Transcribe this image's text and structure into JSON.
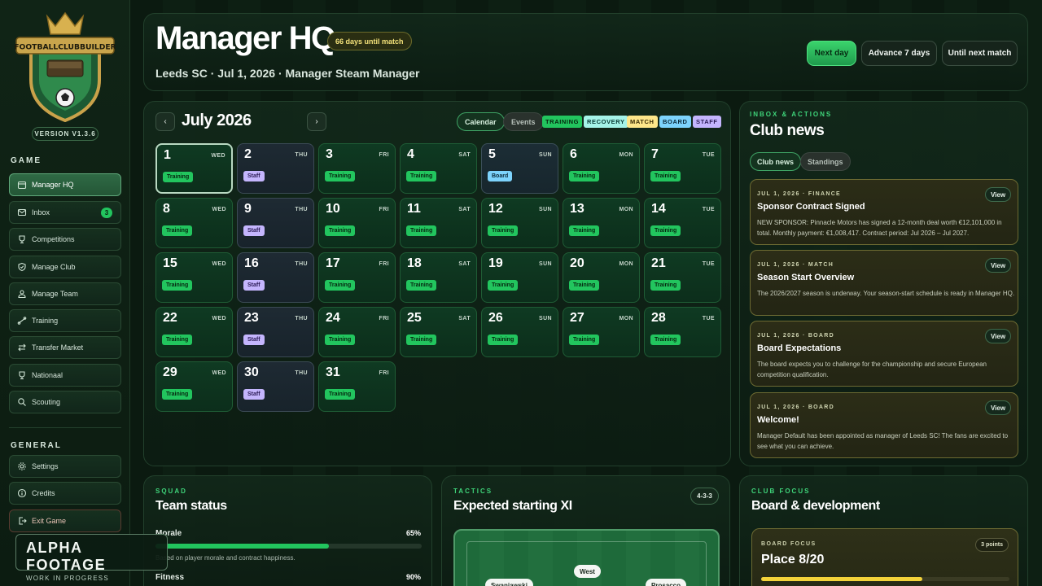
{
  "app": {
    "logo_text": "FOOTBALLCLUBBUILDER",
    "version": "VERSION V1.3.6"
  },
  "sidebar": {
    "game_label": "GAME",
    "general_label": "GENERAL",
    "items": [
      {
        "label": "Manager HQ",
        "icon": "calendar-icon",
        "active": true
      },
      {
        "label": "Inbox",
        "icon": "mail-icon",
        "badge": "3"
      },
      {
        "label": "Competitions",
        "icon": "trophy-icon"
      },
      {
        "label": "Manage Club",
        "icon": "shield-icon"
      },
      {
        "label": "Manage Team",
        "icon": "team-icon"
      },
      {
        "label": "Training",
        "icon": "training-icon"
      },
      {
        "label": "Transfer Market",
        "icon": "transfer-icon"
      },
      {
        "label": "Nationaal",
        "icon": "trophy-icon"
      },
      {
        "label": "Scouting",
        "icon": "search-icon"
      }
    ],
    "general_items": [
      {
        "label": "Settings",
        "icon": "gear-icon"
      },
      {
        "label": "Credits",
        "icon": "info-icon"
      },
      {
        "label": "Exit Game",
        "icon": "exit-icon"
      }
    ]
  },
  "watermark": {
    "title": "ALPHA FOOTAGE",
    "subtitle": "WORK IN PROGRESS"
  },
  "header": {
    "title": "Manager HQ",
    "countdown": "66 days until match",
    "subtitle": "Leeds SC · Jul 1, 2026 · Manager Steam Manager",
    "buttons": {
      "next_day": "Next day",
      "advance_7": "Advance 7 days",
      "until_match": "Until next match"
    }
  },
  "calendar": {
    "title": "July 2026",
    "prev": "‹",
    "next": "›",
    "view_calendar": "Calendar",
    "view_events": "Events",
    "legend": [
      {
        "label": "TRAINING",
        "color": "#22c55e"
      },
      {
        "label": "RECOVERY",
        "color": "#a5f3e8"
      },
      {
        "label": "MATCH",
        "color": "#fde68a"
      },
      {
        "label": "BOARD",
        "color": "#7dd3fc"
      },
      {
        "label": "STAFF",
        "color": "#c4b5fd"
      }
    ],
    "days": [
      {
        "num": "1",
        "dow": "WED",
        "event": "Training",
        "type": "training"
      },
      {
        "num": "2",
        "dow": "THU",
        "event": "Staff",
        "type": "staff"
      },
      {
        "num": "3",
        "dow": "FRI",
        "event": "Training",
        "type": "training"
      },
      {
        "num": "4",
        "dow": "SAT",
        "event": "Training",
        "type": "training"
      },
      {
        "num": "5",
        "dow": "SUN",
        "event": "Board",
        "type": "board"
      },
      {
        "num": "6",
        "dow": "MON",
        "event": "Training",
        "type": "training"
      },
      {
        "num": "7",
        "dow": "TUE",
        "event": "Training",
        "type": "training"
      },
      {
        "num": "8",
        "dow": "WED",
        "event": "Training",
        "type": "training"
      },
      {
        "num": "9",
        "dow": "THU",
        "event": "Staff",
        "type": "staff"
      },
      {
        "num": "10",
        "dow": "FRI",
        "event": "Training",
        "type": "training"
      },
      {
        "num": "11",
        "dow": "SAT",
        "event": "Training",
        "type": "training"
      },
      {
        "num": "12",
        "dow": "SUN",
        "event": "Training",
        "type": "training"
      },
      {
        "num": "13",
        "dow": "MON",
        "event": "Training",
        "type": "training"
      },
      {
        "num": "14",
        "dow": "TUE",
        "event": "Training",
        "type": "training"
      },
      {
        "num": "15",
        "dow": "WED",
        "event": "Training",
        "type": "training"
      },
      {
        "num": "16",
        "dow": "THU",
        "event": "Staff",
        "type": "staff"
      },
      {
        "num": "17",
        "dow": "FRI",
        "event": "Training",
        "type": "training"
      },
      {
        "num": "18",
        "dow": "SAT",
        "event": "Training",
        "type": "training"
      },
      {
        "num": "19",
        "dow": "SUN",
        "event": "Training",
        "type": "training"
      },
      {
        "num": "20",
        "dow": "MON",
        "event": "Training",
        "type": "training"
      },
      {
        "num": "21",
        "dow": "TUE",
        "event": "Training",
        "type": "training"
      },
      {
        "num": "22",
        "dow": "WED",
        "event": "Training",
        "type": "training"
      },
      {
        "num": "23",
        "dow": "THU",
        "event": "Staff",
        "type": "staff"
      },
      {
        "num": "24",
        "dow": "FRI",
        "event": "Training",
        "type": "training"
      },
      {
        "num": "25",
        "dow": "SAT",
        "event": "Training",
        "type": "training"
      },
      {
        "num": "26",
        "dow": "SUN",
        "event": "Training",
        "type": "training"
      },
      {
        "num": "27",
        "dow": "MON",
        "event": "Training",
        "type": "training"
      },
      {
        "num": "28",
        "dow": "TUE",
        "event": "Training",
        "type": "training"
      },
      {
        "num": "29",
        "dow": "WED",
        "event": "Training",
        "type": "training"
      },
      {
        "num": "30",
        "dow": "THU",
        "event": "Staff",
        "type": "staff"
      },
      {
        "num": "31",
        "dow": "FRI",
        "event": "Training",
        "type": "training"
      }
    ]
  },
  "news": {
    "eyebrow": "INBOX & ACTIONS",
    "title": "Club news",
    "tab_news": "Club news",
    "tab_standings": "Standings",
    "view_label": "View",
    "items": [
      {
        "meta": "JUL 1, 2026 · FINANCE",
        "title": "Sponsor Contract Signed",
        "body": "NEW SPONSOR: Pinnacle Motors has signed a 12-month deal worth €12,101,000 in total. Monthly payment: €1,008,417. Contract period: Jul 2026 – Jul 2027."
      },
      {
        "meta": "JUL 1, 2026 · MATCH",
        "title": "Season Start Overview",
        "body": "The 2026/2027 season is underway. Your season-start schedule is ready in Manager HQ."
      },
      {
        "meta": "JUL 1, 2026 · BOARD",
        "title": "Board Expectations",
        "body": "The board expects you to challenge for the championship and secure European competition qualification."
      },
      {
        "meta": "JUL 1, 2026 · BOARD",
        "title": "Welcome!",
        "body": "Manager Default has been appointed as manager of Leeds SC! The fans are excited to see what you can achieve."
      }
    ]
  },
  "squad": {
    "eyebrow": "SQUAD",
    "title": "Team status",
    "morale_label": "Morale",
    "morale_value": "65%",
    "morale_pct": 65,
    "morale_note": "Based on player morale and contract happiness.",
    "fitness_label": "Fitness",
    "fitness_value": "90%"
  },
  "tactics": {
    "eyebrow": "TACTICS",
    "title": "Expected starting XI",
    "formation": "4-3-3",
    "players": [
      "West",
      "Swaniawski",
      "Prosacco"
    ]
  },
  "focus": {
    "eyebrow": "CLUB FOCUS",
    "title": "Board & development",
    "card_eyebrow": "BOARD FOCUS",
    "card_title": "Place 8/20",
    "points": "3 points",
    "progress_pct": 65
  }
}
